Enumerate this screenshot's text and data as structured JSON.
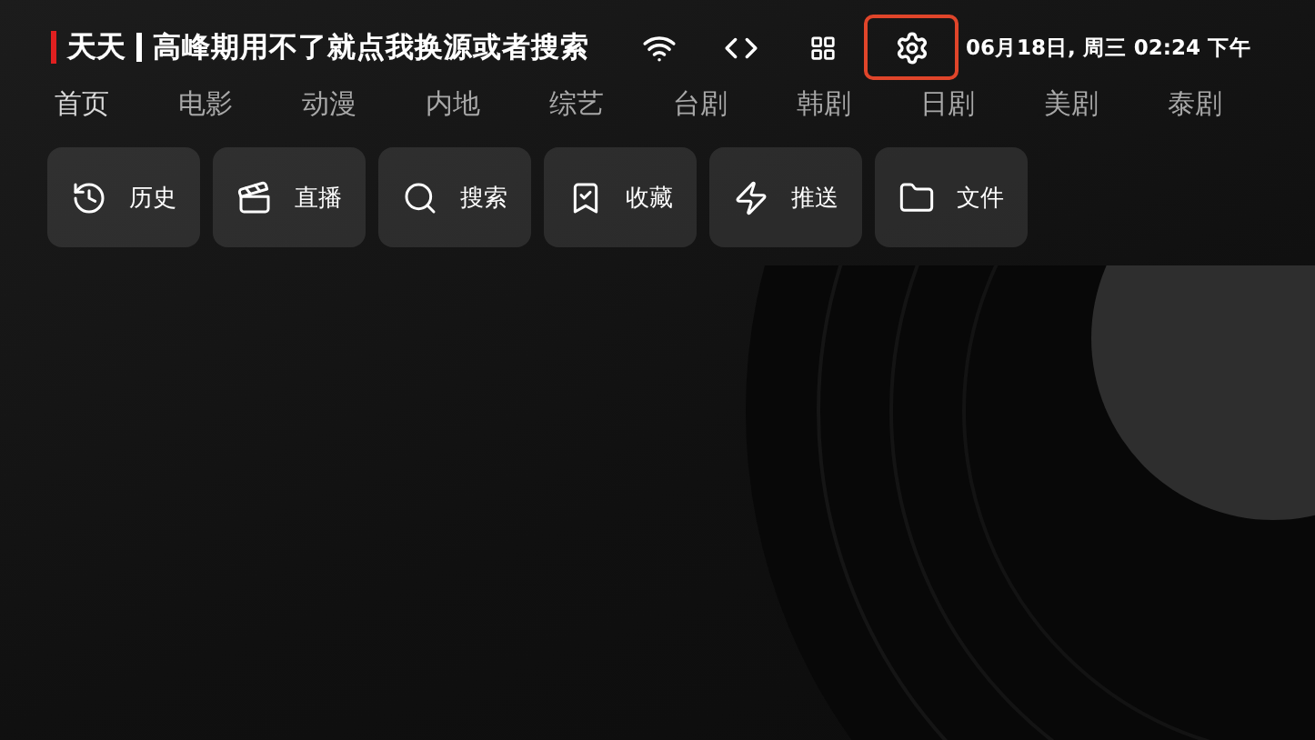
{
  "header": {
    "app_name": "天天",
    "notice": "高峰期用不了就点我换源或者搜索",
    "toolbar": [
      {
        "kind": "wifi",
        "focused": false
      },
      {
        "kind": "code",
        "focused": false
      },
      {
        "kind": "grid",
        "focused": false
      },
      {
        "kind": "settings",
        "focused": true
      }
    ],
    "datetime": "06月18日, 周三 02:24 下午"
  },
  "categories": [
    {
      "label": "首页",
      "selected": true
    },
    {
      "label": "电影",
      "selected": false
    },
    {
      "label": "动漫",
      "selected": false
    },
    {
      "label": "内地",
      "selected": false
    },
    {
      "label": "综艺",
      "selected": false
    },
    {
      "label": "台剧",
      "selected": false
    },
    {
      "label": "韩剧",
      "selected": false
    },
    {
      "label": "日剧",
      "selected": false
    },
    {
      "label": "美剧",
      "selected": false
    },
    {
      "label": "泰剧",
      "selected": false
    }
  ],
  "shortcuts": [
    {
      "kind": "history",
      "label": "历史"
    },
    {
      "kind": "live",
      "label": "直播"
    },
    {
      "kind": "search",
      "label": "搜索"
    },
    {
      "kind": "favorites",
      "label": "收藏"
    },
    {
      "kind": "push",
      "label": "推送"
    },
    {
      "kind": "files",
      "label": "文件"
    }
  ]
}
